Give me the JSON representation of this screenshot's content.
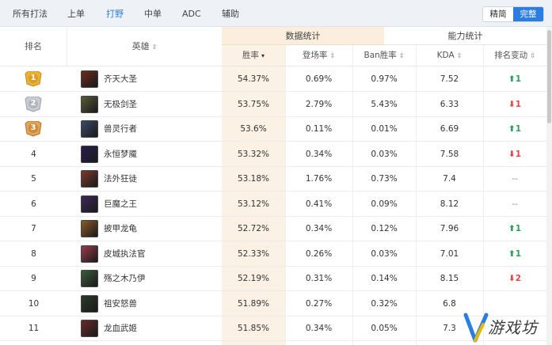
{
  "tabs": [
    {
      "label": "所有打法",
      "active": false
    },
    {
      "label": "上单",
      "active": false
    },
    {
      "label": "打野",
      "active": true
    },
    {
      "label": "中单",
      "active": false
    },
    {
      "label": "ADC",
      "active": false
    },
    {
      "label": "辅助",
      "active": false
    }
  ],
  "modes": [
    {
      "label": "精简",
      "active": false
    },
    {
      "label": "完整",
      "active": true
    }
  ],
  "table": {
    "group_data_label": "数据统计",
    "group_ability_label": "能力统计",
    "columns": {
      "rank": "排名",
      "hero": "英雄",
      "win": "胜率",
      "pick": "登场率",
      "ban": "Ban胜率",
      "kda": "KDA",
      "change": "排名变动"
    },
    "sort_icon": "⇕",
    "sort_active_icon": "▾",
    "rows": [
      {
        "rank": "1",
        "medal": "gold",
        "name": "齐天大圣",
        "win": "54.37%",
        "pick": "0.69%",
        "ban": "0.97%",
        "kda": "7.52",
        "dir": "up",
        "arrow": "⬆",
        "change": "1",
        "icon_color": "#6b2b1e"
      },
      {
        "rank": "2",
        "medal": "silver",
        "name": "无极剑圣",
        "win": "53.75%",
        "pick": "2.79%",
        "ban": "5.43%",
        "kda": "6.33",
        "dir": "down",
        "arrow": "⬇",
        "change": "1",
        "icon_color": "#5a5a3a"
      },
      {
        "rank": "3",
        "medal": "bronze",
        "name": "兽灵行者",
        "win": "53.6%",
        "pick": "0.11%",
        "ban": "0.01%",
        "kda": "6.69",
        "dir": "up",
        "arrow": "⬆",
        "change": "1",
        "icon_color": "#3a4a6a"
      },
      {
        "rank": "4",
        "medal": "",
        "name": "永恒梦魇",
        "win": "53.32%",
        "pick": "0.34%",
        "ban": "0.03%",
        "kda": "7.58",
        "dir": "down",
        "arrow": "⬇",
        "change": "1",
        "icon_color": "#2a1e4e"
      },
      {
        "rank": "5",
        "medal": "",
        "name": "法外狂徒",
        "win": "53.18%",
        "pick": "1.76%",
        "ban": "0.73%",
        "kda": "7.4",
        "dir": "none",
        "arrow": "",
        "change": "--",
        "icon_color": "#7a3a2a"
      },
      {
        "rank": "6",
        "medal": "",
        "name": "巨魔之王",
        "win": "53.12%",
        "pick": "0.41%",
        "ban": "0.09%",
        "kda": "8.12",
        "dir": "none",
        "arrow": "",
        "change": "--",
        "icon_color": "#3a2a5a"
      },
      {
        "rank": "7",
        "medal": "",
        "name": "披甲龙龟",
        "win": "52.72%",
        "pick": "0.34%",
        "ban": "0.12%",
        "kda": "7.96",
        "dir": "up",
        "arrow": "⬆",
        "change": "1",
        "icon_color": "#8a5a2a"
      },
      {
        "rank": "8",
        "medal": "",
        "name": "皮城执法官",
        "win": "52.33%",
        "pick": "0.26%",
        "ban": "0.03%",
        "kda": "7.01",
        "dir": "up",
        "arrow": "⬆",
        "change": "1",
        "icon_color": "#9a3a4a"
      },
      {
        "rank": "9",
        "medal": "",
        "name": "殇之木乃伊",
        "win": "52.19%",
        "pick": "0.31%",
        "ban": "0.14%",
        "kda": "8.15",
        "dir": "down",
        "arrow": "⬇",
        "change": "2",
        "icon_color": "#3a5a3a"
      },
      {
        "rank": "10",
        "medal": "",
        "name": "祖安怒兽",
        "win": "51.89%",
        "pick": "0.27%",
        "ban": "0.32%",
        "kda": "6.8",
        "dir": "none",
        "arrow": "",
        "change": "",
        "icon_color": "#2a3a2a"
      },
      {
        "rank": "11",
        "medal": "",
        "name": "龙血武姬",
        "win": "51.85%",
        "pick": "0.34%",
        "ban": "0.05%",
        "kda": "7.3",
        "dir": "none",
        "arrow": "",
        "change": "",
        "icon_color": "#6a2a2a"
      }
    ]
  },
  "watermark": {
    "text": "游戏坊"
  },
  "colors": {
    "accent": "#2b7de0",
    "up": "#2ca05a",
    "down": "#e04848",
    "win_column": "#fbf1e4"
  }
}
